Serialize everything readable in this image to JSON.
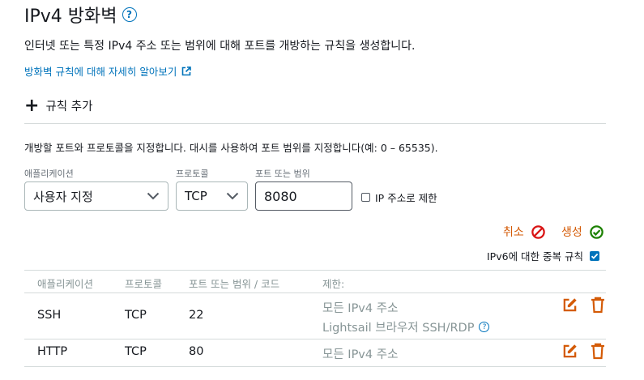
{
  "header": {
    "title": "IPv4 방화벽",
    "help_glyph": "?",
    "description": "인터넷 또는 특정 IPv4 주소 또는 범위에 대해 포트를 개방하는 규칙을 생성합니다.",
    "learn_more": "방화벽 규칙에 대해 자세히 알아보기"
  },
  "add_rule": {
    "label": "규칙 추가"
  },
  "form": {
    "hint": "개방할 포트와 프로토콜을 지정합니다. 대시를 사용하여 포트 범위를 지정합니다(예: 0 – 65535).",
    "application_label": "애플리케이션",
    "application_value": "사용자 지정",
    "protocol_label": "프로토콜",
    "protocol_value": "TCP",
    "port_label": "포트 또는 범위",
    "port_value": "8080",
    "restrict_ip_label": "IP 주소로 제한",
    "restrict_ip_checked": false,
    "cancel_label": "취소",
    "create_label": "생성",
    "dup_ipv6_label": "IPv6에 대한 중복 규칙",
    "dup_ipv6_checked": true
  },
  "table": {
    "headers": [
      "애플리케이션",
      "프로토콜",
      "포트 또는 범위 / 코드",
      "제한:"
    ],
    "rows": [
      {
        "application": "SSH",
        "protocol": "TCP",
        "port": "22",
        "restriction": "모든 IPv4 주소",
        "restriction_extra": "Lightsail 브라우저 SSH/RDP"
      },
      {
        "application": "HTTP",
        "protocol": "TCP",
        "port": "80",
        "restriction": "모든 IPv4 주소"
      }
    ]
  },
  "colors": {
    "link": "#0073bb",
    "accent_orange": "#d45b07",
    "success_green": "#1d8102",
    "muted": "#879596",
    "divider": "#d5dbdb"
  }
}
